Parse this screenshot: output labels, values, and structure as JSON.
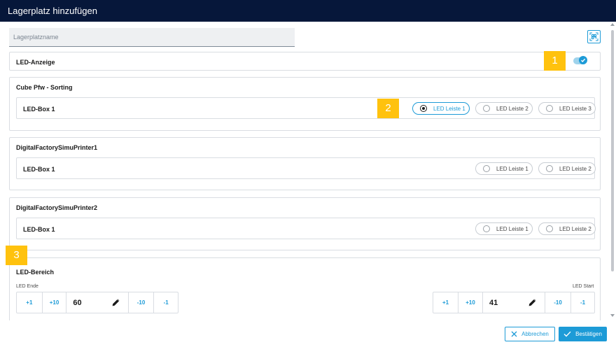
{
  "dialog": {
    "title": "Lagerplatz hinzufügen"
  },
  "name_field": {
    "placeholder": "Lagerplatzname",
    "value": ""
  },
  "icons": {
    "scan": "qr-scan-icon",
    "edit": "pencil-icon",
    "cancel": "close-icon",
    "confirm": "check-icon"
  },
  "led_display": {
    "label": "LED-Anzeige",
    "enabled": true
  },
  "groups": [
    {
      "title": "Cube Pfw - Sorting",
      "box_label": "LED-Box 1",
      "options": [
        "LED Leiste 1",
        "LED Leiste 2",
        "LED Leiste 3"
      ],
      "selected": 0
    },
    {
      "title": "DigitalFactorySimuPrinter1",
      "box_label": "LED-Box 1",
      "options": [
        "LED Leiste 1",
        "LED Leiste 2"
      ],
      "selected": null
    },
    {
      "title": "DigitalFactorySimuPrinter2",
      "box_label": "LED-Box 1",
      "options": [
        "LED Leiste 1",
        "LED Leiste 2"
      ],
      "selected": null
    }
  ],
  "led_range": {
    "title": "LED-Bereich",
    "end": {
      "label": "LED Ende",
      "value": "60",
      "buttons": [
        "+1",
        "+10",
        "-10",
        "-1"
      ]
    },
    "start": {
      "label": "LED Start",
      "value": "41",
      "buttons": [
        "+1",
        "+10",
        "-10",
        "-1"
      ]
    }
  },
  "badges": [
    "1",
    "2",
    "3"
  ],
  "footer": {
    "cancel_label": "Abbrechen",
    "confirm_label": "Bestätigen"
  },
  "colors": {
    "header_bg": "#06173a",
    "accent": "#1d9bd7",
    "badge": "#ffc20e"
  }
}
